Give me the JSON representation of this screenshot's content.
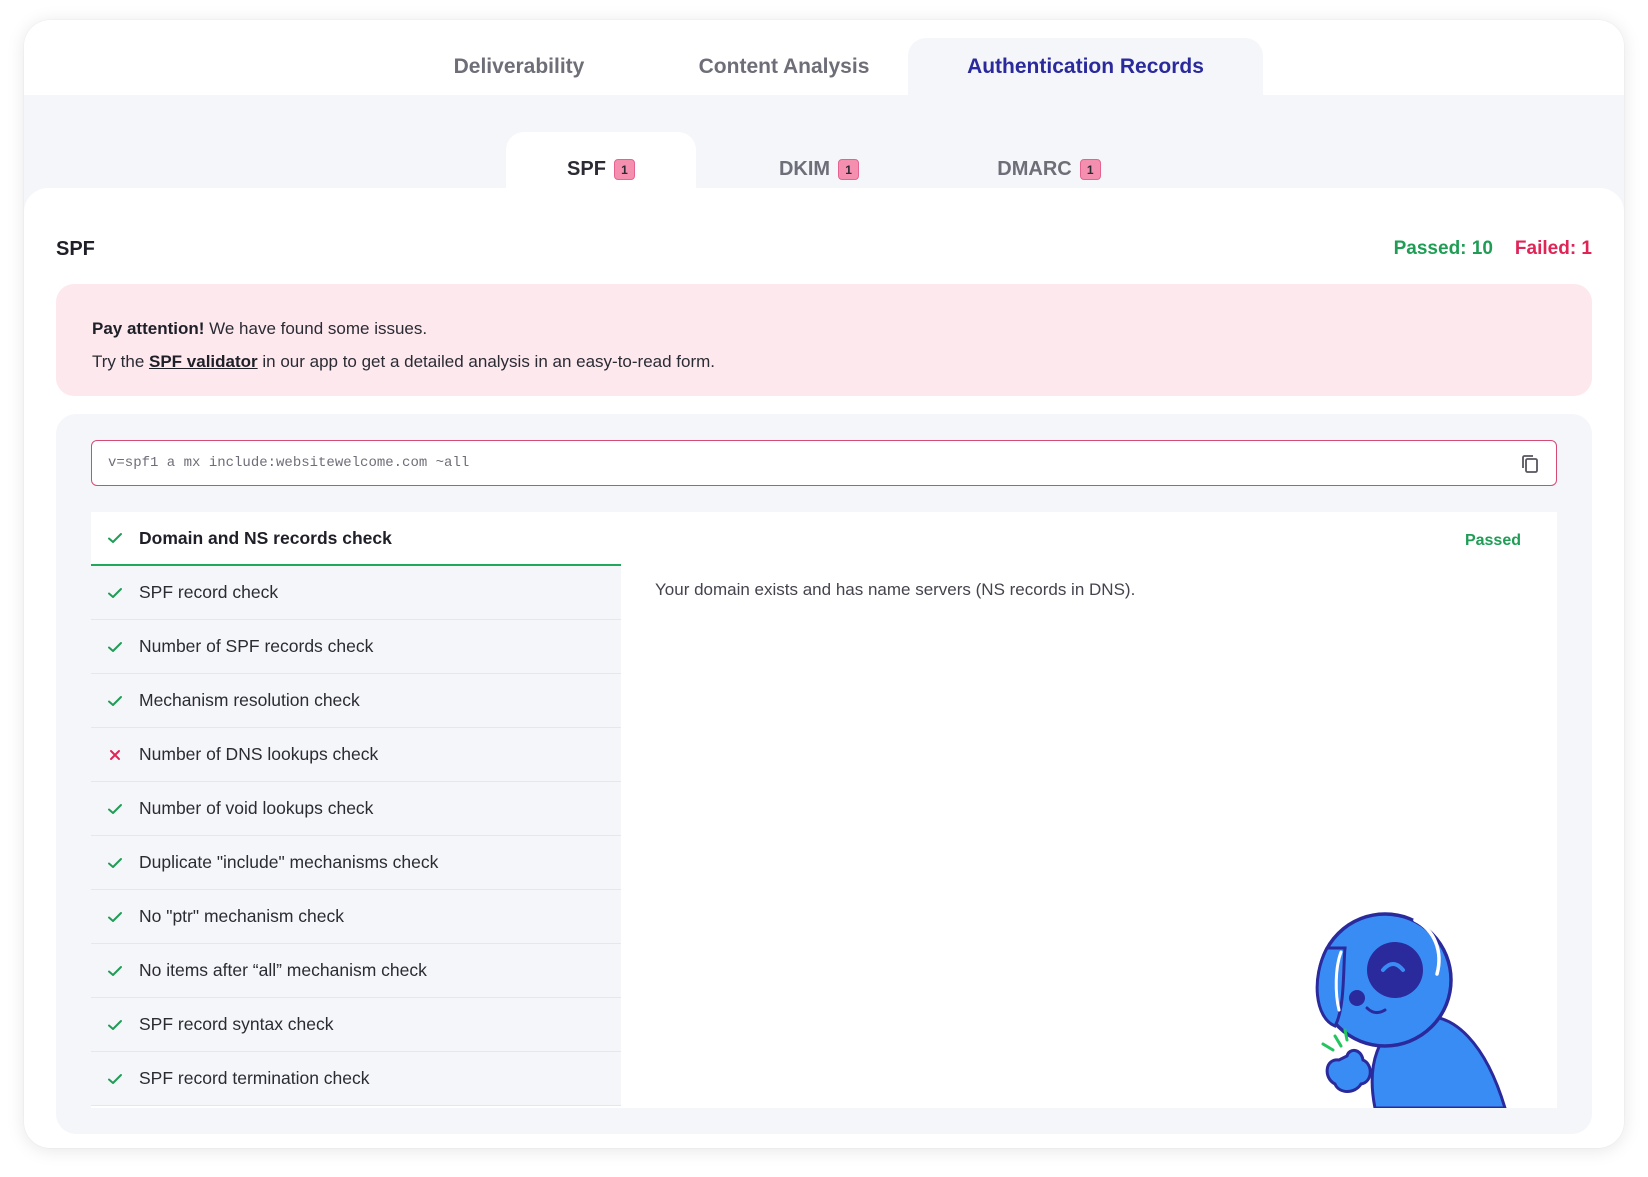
{
  "main_tabs": [
    {
      "label": "Deliverability"
    },
    {
      "label": "Content Analysis"
    },
    {
      "label": "Authentication Records"
    }
  ],
  "sub_tabs": [
    {
      "label": "SPF",
      "badge": "1"
    },
    {
      "label": "DKIM",
      "badge": "1"
    },
    {
      "label": "DMARC",
      "badge": "1"
    }
  ],
  "panel": {
    "title": "SPF",
    "passed": "Passed: 10",
    "failed": "Failed: 1"
  },
  "alert": {
    "bold": "Pay attention!",
    "line1": " We have found some issues.",
    "line2_prefix": "Try the ",
    "link": "SPF validator",
    "line2_suffix": " in our app to get a detailed analysis in an easy-to-read form."
  },
  "record": {
    "value": "v=spf1 a mx include:websitewelcome.com ~all"
  },
  "checks": [
    {
      "label": "Domain and NS records check",
      "status": "pass"
    },
    {
      "label": "SPF record check",
      "status": "pass"
    },
    {
      "label": "Number of SPF records check",
      "status": "pass"
    },
    {
      "label": "Mechanism resolution check",
      "status": "pass"
    },
    {
      "label": "Number of DNS lookups check",
      "status": "fail"
    },
    {
      "label": "Number of void lookups check",
      "status": "pass"
    },
    {
      "label": "Duplicate \"include\" mechanisms check",
      "status": "pass"
    },
    {
      "label": "No \"ptr\" mechanism check",
      "status": "pass"
    },
    {
      "label": "No items after “all” mechanism check",
      "status": "pass"
    },
    {
      "label": "SPF record syntax check",
      "status": "pass"
    },
    {
      "label": "SPF record termination check",
      "status": "pass"
    }
  ],
  "detail": {
    "status": "Passed",
    "text": "Your domain exists and has name servers (NS records in DNS)."
  },
  "colors": {
    "accent": "#2a2a9c",
    "pass": "#1f9d55",
    "fail": "#e02456",
    "alert_bg": "#fde8ee",
    "mascot": "#3a8cf5"
  }
}
